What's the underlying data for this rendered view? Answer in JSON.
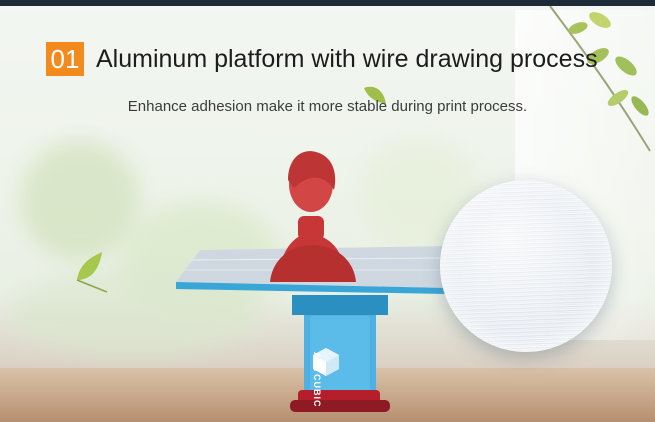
{
  "headline": {
    "number": "01",
    "title": "Aluminum platform with wire drawing process"
  },
  "subtitle": "Enhance adhesion make it more stable during print process.",
  "printer": {
    "brand": "ANYCUBIC"
  },
  "colors": {
    "accent": "#f28a1e",
    "platform_edge": "#3aa6d8",
    "printer_body": "#4fb1e3",
    "model": "#c83737"
  }
}
